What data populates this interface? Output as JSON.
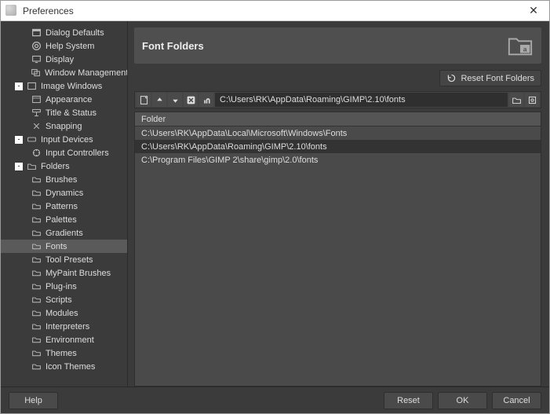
{
  "window": {
    "title": "Preferences"
  },
  "sidebar": {
    "top": [
      {
        "label": "Dialog Defaults",
        "icon": "dialog"
      },
      {
        "label": "Help System",
        "icon": "help"
      },
      {
        "label": "Display",
        "icon": "display"
      },
      {
        "label": "Window Management",
        "icon": "window"
      }
    ],
    "groups": [
      {
        "label": "Image Windows",
        "toggle": "-",
        "children": [
          {
            "label": "Appearance",
            "icon": "appearance"
          },
          {
            "label": "Title & Status",
            "icon": "title"
          },
          {
            "label": "Snapping",
            "icon": "snap"
          }
        ]
      },
      {
        "label": "Input Devices",
        "toggle": "-",
        "children": [
          {
            "label": "Input Controllers",
            "icon": "controllers"
          }
        ]
      },
      {
        "label": "Folders",
        "toggle": "-",
        "children": [
          {
            "label": "Brushes"
          },
          {
            "label": "Dynamics"
          },
          {
            "label": "Patterns"
          },
          {
            "label": "Palettes"
          },
          {
            "label": "Gradients"
          },
          {
            "label": "Fonts",
            "selected": true
          },
          {
            "label": "Tool Presets"
          },
          {
            "label": "MyPaint Brushes"
          },
          {
            "label": "Plug-ins"
          },
          {
            "label": "Scripts"
          },
          {
            "label": "Modules"
          },
          {
            "label": "Interpreters"
          },
          {
            "label": "Environment"
          },
          {
            "label": "Themes"
          },
          {
            "label": "Icon Themes"
          }
        ]
      }
    ]
  },
  "content": {
    "title": "Font Folders",
    "reset_label": "Reset Font Folders",
    "path_value": "C:\\Users\\RK\\AppData\\Roaming\\GIMP\\2.10\\fonts",
    "list_header": "Folder",
    "folders": [
      {
        "path": "C:\\Users\\RK\\AppData\\Local\\Microsoft\\Windows\\Fonts",
        "selected": false
      },
      {
        "path": "C:\\Users\\RK\\AppData\\Roaming\\GIMP\\2.10\\fonts",
        "selected": true
      },
      {
        "path": "C:\\Program Files\\GIMP 2\\share\\gimp\\2.0\\fonts",
        "selected": false
      }
    ]
  },
  "footer": {
    "help": "Help",
    "reset": "Reset",
    "ok": "OK",
    "cancel": "Cancel"
  }
}
